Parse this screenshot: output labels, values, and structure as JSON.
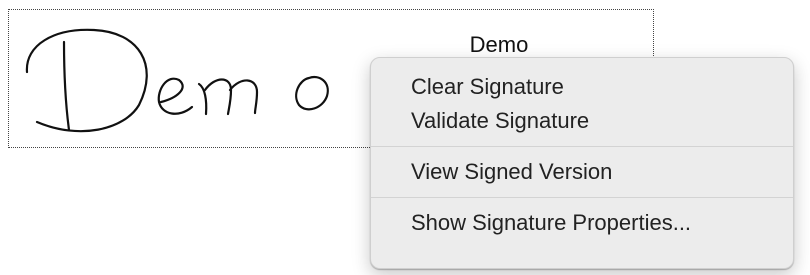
{
  "signature_field": {
    "signer_name": "Demo"
  },
  "context_menu": {
    "groups": [
      [
        "Clear Signature",
        "Validate Signature"
      ],
      [
        "View Signed Version"
      ],
      [
        "Show Signature Properties..."
      ]
    ]
  }
}
